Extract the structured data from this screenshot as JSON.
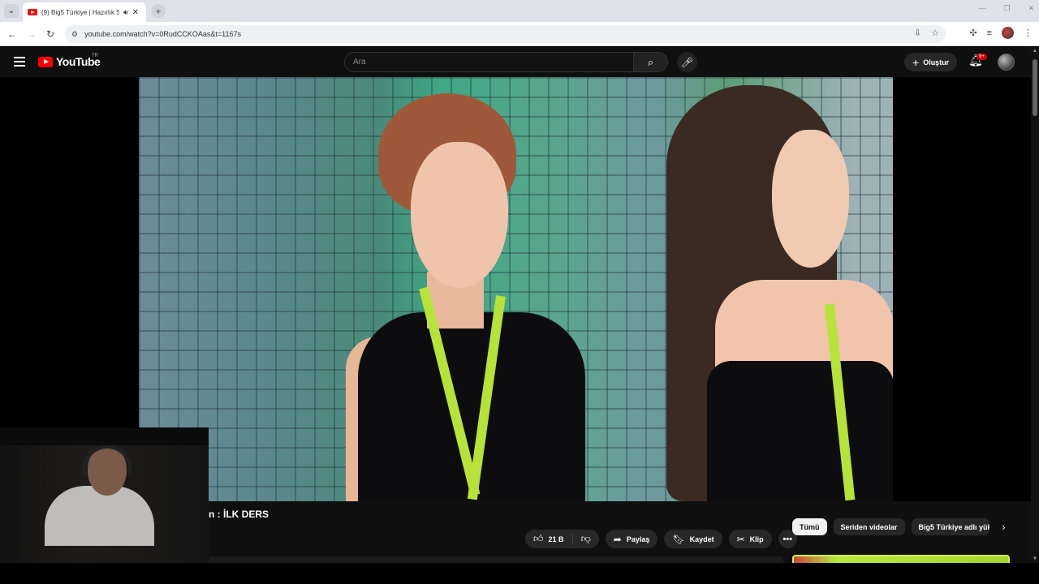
{
  "browser": {
    "tab_title": "(9) Big5 Türkiye | Hazırlık Sc",
    "tab_audio_icon": "speaker-icon",
    "url": "youtube.com/watch?v=0RudCCKOAas&t=1167s"
  },
  "youtube": {
    "logo_text": "YouTube",
    "country_code": "TR",
    "search_placeholder": "Ara",
    "create_label": "Oluştur",
    "notification_count": "9+"
  },
  "video": {
    "title_visible": "n : İLK DERS",
    "actions": {
      "like_count": "21 B",
      "share_label": "Paylaş",
      "save_label": "Kaydet",
      "clip_label": "Klip"
    }
  },
  "sidebar": {
    "chips": [
      "Tümü",
      "Seriden videolar",
      "Big5 Türkiye adlı yükl"
    ]
  },
  "colors": {
    "yt_red": "#ff0000",
    "lanyard_green": "#b6e23a",
    "header_bg": "#0f0f0f"
  }
}
